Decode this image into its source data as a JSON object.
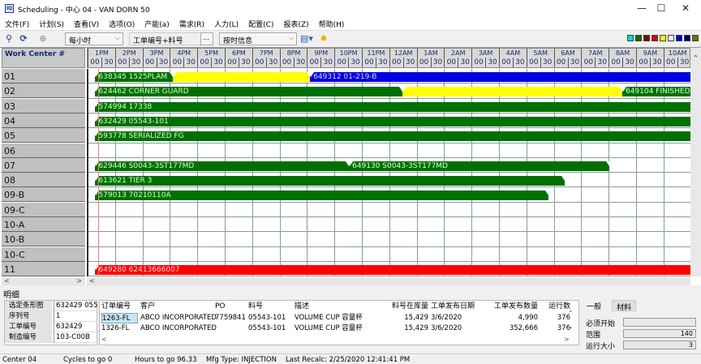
{
  "window": {
    "title": "Scheduling - 中心 04 - VAN DORN 50",
    "app_icon": "IQ",
    "minimize": "—",
    "maximize": "☐",
    "close": "✕"
  },
  "menu": [
    "文件(F)",
    "计划(S)",
    "查看(V)",
    "选项(O)",
    "产能(a)",
    "需求(R)",
    "人力(L)",
    "配置(C)",
    "报表(Z)",
    "帮助(H)"
  ],
  "toolbar": {
    "icons": [
      "binoculars-icon",
      "refresh-icon",
      "zoom-icon"
    ],
    "scale_select": "每小时",
    "label_select": "工单编号+料号",
    "ellipsis": "...",
    "info_select": "按时信息",
    "legend_colors": [
      "#00d8d8",
      "#007000",
      "#800000",
      "#e00000",
      "#ffff00",
      "#ffe8f0",
      "#0000e0",
      "#000070",
      "#707000"
    ]
  },
  "gantt": {
    "header": "Work Center #",
    "hours": [
      "1PM",
      "2PM",
      "3PM",
      "4PM",
      "5PM",
      "6PM",
      "7PM",
      "8PM",
      "9PM",
      "10PM",
      "11PM",
      "12AM",
      "1AM",
      "2AM",
      "3AM",
      "4AM",
      "5AM",
      "6AM",
      "7AM",
      "8AM",
      "9AM",
      "10AM"
    ],
    "minutes": [
      "00",
      "30"
    ],
    "colors": {
      "green": "#007000",
      "yellow": "#ffff00",
      "blue": "#0000e0",
      "red": "#ff0000"
    },
    "rows": [
      {
        "id": "01",
        "bars": [
          {
            "start": "13:15",
            "end": "16:05",
            "color": "green",
            "label": "638345 1525PLAM"
          },
          {
            "start": "16:05",
            "end": "21:05",
            "color": "yellow",
            "label": ""
          },
          {
            "start": "21:05",
            "end": "",
            "color": "blue",
            "label": "649312 01-219-B"
          }
        ]
      },
      {
        "id": "02",
        "bars": [
          {
            "start": "13:15",
            "end": "00:27",
            "color": "green",
            "label": "624462 CORNER GUARD"
          },
          {
            "start": "00:27",
            "end": "08:28",
            "color": "yellow",
            "label": ""
          },
          {
            "start": "08:28",
            "end": "",
            "color": "green",
            "label": "649104 FINISHED GOODS"
          }
        ]
      },
      {
        "id": "03",
        "bars": [
          {
            "start": "13:15",
            "end": "",
            "color": "green",
            "label": "574994 17338"
          }
        ]
      },
      {
        "id": "04",
        "bars": [
          {
            "start": "13:15",
            "end": "",
            "color": "green",
            "label": "632429 05543-101"
          }
        ]
      },
      {
        "id": "05",
        "bars": [
          {
            "start": "13:15",
            "end": "",
            "color": "green",
            "label": "593778 SERIALIZED FG"
          }
        ]
      },
      {
        "id": "06",
        "bars": []
      },
      {
        "id": "07",
        "bars": [
          {
            "start": "13:15",
            "end": "22:30",
            "color": "green",
            "label": "629446 S0043-3ST177MD"
          },
          {
            "start": "22:30",
            "end": "08:00",
            "color": "green",
            "label": "649130 S0043-3ST177MD"
          }
        ]
      },
      {
        "id": "08",
        "bars": [
          {
            "start": "13:15",
            "end": "06:22",
            "color": "green",
            "label": "613621 TIER 3"
          }
        ]
      },
      {
        "id": "09-B",
        "bars": [
          {
            "start": "13:15",
            "end": "05:47",
            "color": "green",
            "label": "579013 70210110A"
          }
        ]
      },
      {
        "id": "09-C",
        "bars": []
      },
      {
        "id": "10-A",
        "bars": []
      },
      {
        "id": "10-B",
        "bars": []
      },
      {
        "id": "10-C",
        "bars": []
      },
      {
        "id": "11",
        "bars": [
          {
            "start": "13:15",
            "end": "",
            "color": "red",
            "label": "649280 62413666007"
          }
        ]
      }
    ],
    "now": "13:22"
  },
  "detail": {
    "label": "明细",
    "props": [
      {
        "k": "选定条形图",
        "v": "632429 05543-101"
      },
      {
        "k": "序列号",
        "v": "1"
      },
      {
        "k": "工单编号",
        "v": "632429"
      },
      {
        "k": "制造编号",
        "v": "103-C00B"
      }
    ],
    "columns": [
      "订单编号",
      "客户",
      "PO",
      "料号",
      "描述",
      "料号在库量",
      "工单发布日期",
      "工单发布数量",
      "运行数"
    ],
    "rows": [
      [
        "1263-FL",
        "ABCO INCORPORATED",
        "7759841",
        "05543-101",
        "VOLUME CUP 容量杯",
        "15,429",
        "3/6/2020",
        "4,990",
        "376"
      ],
      [
        "1326-FL",
        "ABCO INCORPORATED",
        "",
        "05543-101",
        "VOLUME CUP 容量杯",
        "15,429",
        "3/6/2020",
        "352,666",
        "376"
      ]
    ],
    "tabs": [
      "一般",
      "材料"
    ],
    "fields": [
      {
        "label": "必须开始",
        "value": ""
      },
      {
        "label": "范围",
        "value": "140"
      },
      {
        "label": "运行大小",
        "value": "3"
      }
    ]
  },
  "status": [
    "Center 04",
    "Cycles to go 0",
    "Hours to go 96.33",
    "Mfg Type: INJECTION",
    "Last Recalc: 2/25/2020 12:41:41 PM"
  ]
}
